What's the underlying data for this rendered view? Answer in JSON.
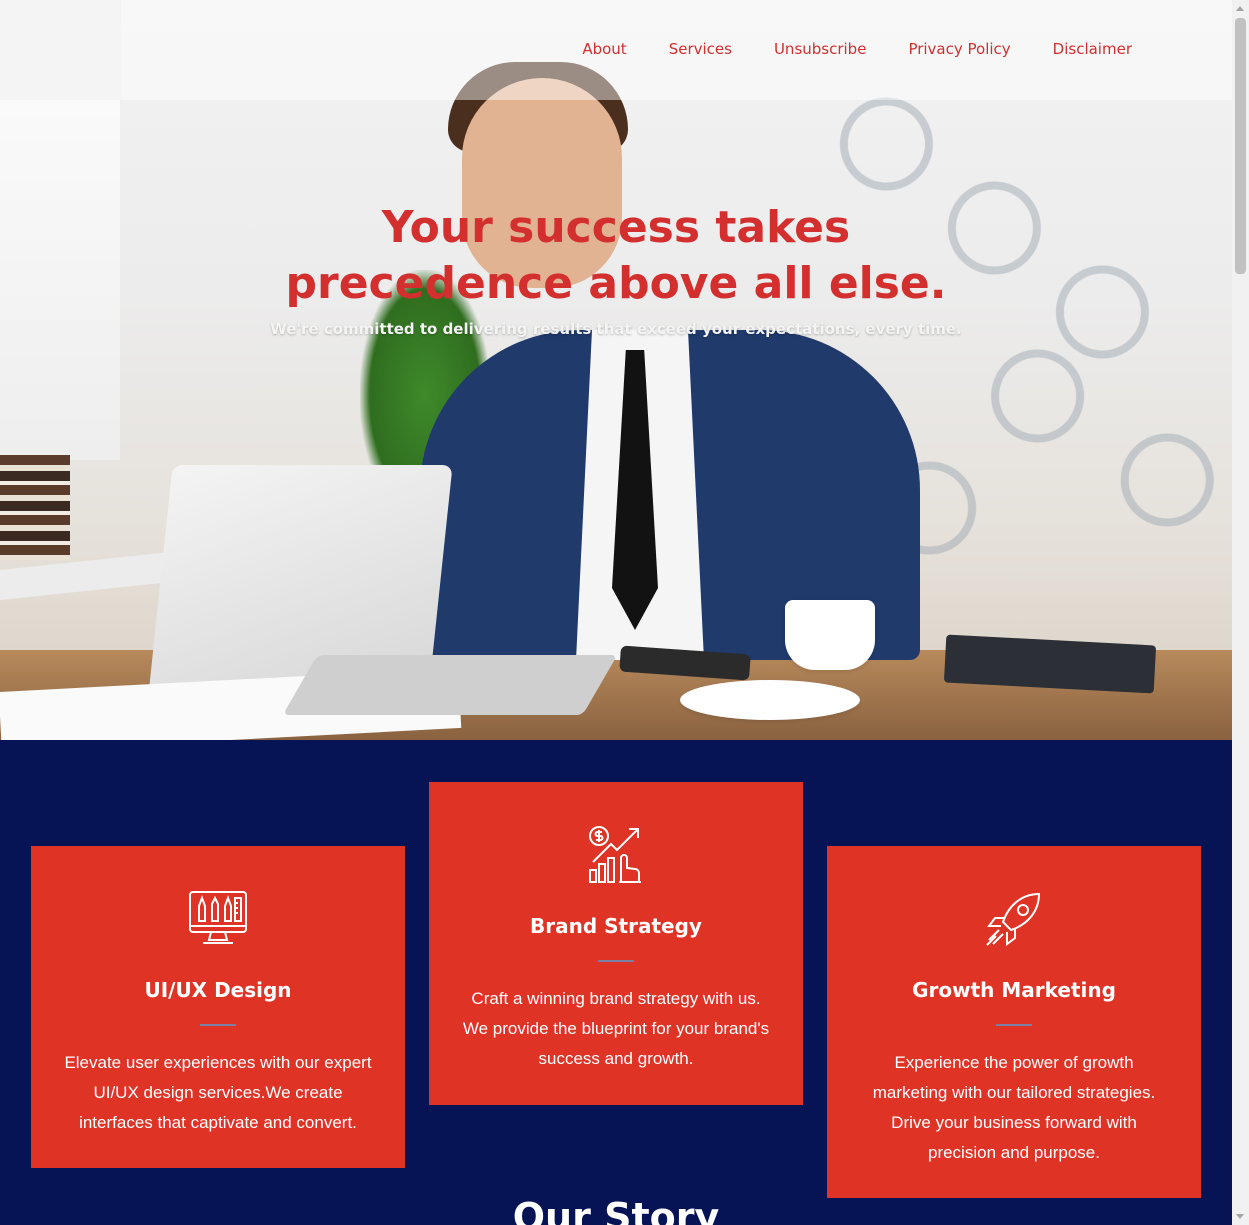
{
  "nav": {
    "items": [
      "About",
      "Services",
      "Unsubscribe",
      "Privacy Policy",
      "Disclaimer"
    ]
  },
  "hero": {
    "title": "Your success takes precedence above all else.",
    "subtitle": "We're committed to delivering results that exceed your expectations, every time."
  },
  "services": {
    "cards": [
      {
        "icon": "design-tools-monitor-icon",
        "title": "UI/UX Design",
        "text": "Elevate user experiences with our expert UI/UX design services.We create interfaces that captivate and convert."
      },
      {
        "icon": "growth-chart-dollar-icon",
        "title": "Brand Strategy",
        "text": "Craft a winning brand strategy with us. We provide the blueprint for your brand's success and growth."
      },
      {
        "icon": "rocket-icon",
        "title": "Growth Marketing",
        "text": "Experience the power of growth marketing with our tailored strategies. Drive your business forward with precision and purpose."
      }
    ]
  },
  "story": {
    "prefix": "Our",
    "highlight": "Story"
  },
  "colors": {
    "accent": "#d32f2f",
    "card": "#df3326",
    "navy": "#061355"
  }
}
